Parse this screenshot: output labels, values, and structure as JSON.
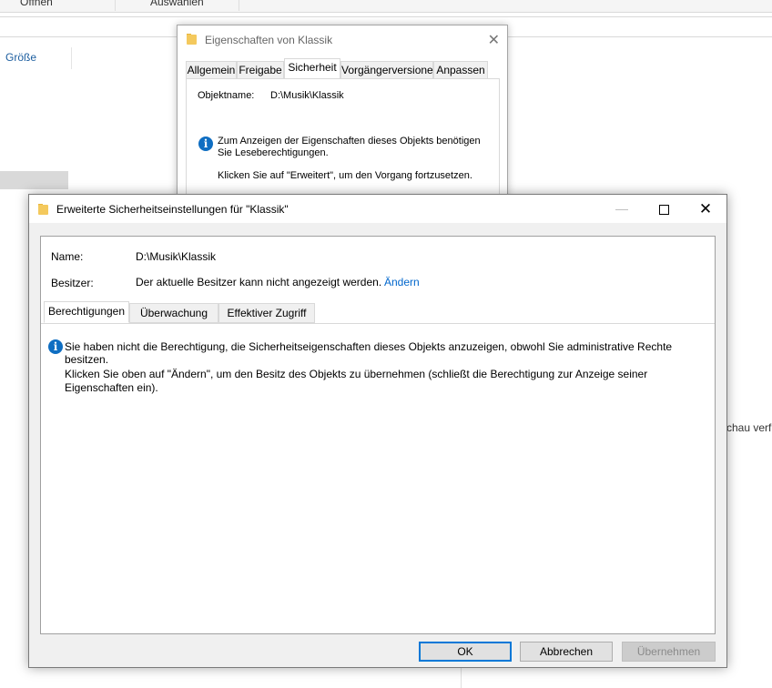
{
  "explorer": {
    "ribbon_open": "Öffnen",
    "ribbon_select": "Auswählen",
    "column_size": "Größe",
    "preview_text": "chau verf"
  },
  "properties_dialog": {
    "title": "Eigenschaften von Klassik",
    "tabs": [
      "Allgemein",
      "Freigabe",
      "Sicherheit",
      "Vorgängerversionen",
      "Anpassen"
    ],
    "active_tab": "Sicherheit",
    "object_label": "Objektname:",
    "object_value": "D:\\Musik\\Klassik",
    "info_message": "Zum Anzeigen der Eigenschaften dieses Objekts benötigen Sie Leseberechtigungen.",
    "continue_message": "Klicken Sie auf \"Erweitert\", um den Vorgang fortzusetzen."
  },
  "advanced_dialog": {
    "title": "Erweiterte Sicherheitseinstellungen für \"Klassik\"",
    "name_label": "Name:",
    "name_value": "D:\\Musik\\Klassik",
    "owner_label": "Besitzer:",
    "owner_value": "Der aktuelle Besitzer kann nicht angezeigt werden.",
    "change_link": "Ändern",
    "tabs": [
      "Berechtigungen",
      "Überwachung",
      "Effektiver Zugriff"
    ],
    "active_tab": "Berechtigungen",
    "info_message": "Sie haben nicht die Berechtigung, die Sicherheitseigenschaften dieses Objekts anzuzeigen, obwohl Sie administrative Rechte besitzen.",
    "hint_message": "Klicken Sie oben auf \"Ändern\", um den Besitz des Objekts zu übernehmen (schließt die Berechtigung zur Anzeige seiner Eigenschaften ein).",
    "buttons": {
      "ok": "OK",
      "cancel": "Abbrechen",
      "apply": "Übernehmen"
    },
    "apply_enabled": false
  },
  "colors": {
    "accent": "#0078d7",
    "link": "#0066cc",
    "info_icon": "#0f6ec2",
    "folder": "#f4c95d"
  },
  "icons": [
    "folder-icon",
    "info-icon",
    "close-icon",
    "minimize-icon",
    "maximize-icon"
  ]
}
